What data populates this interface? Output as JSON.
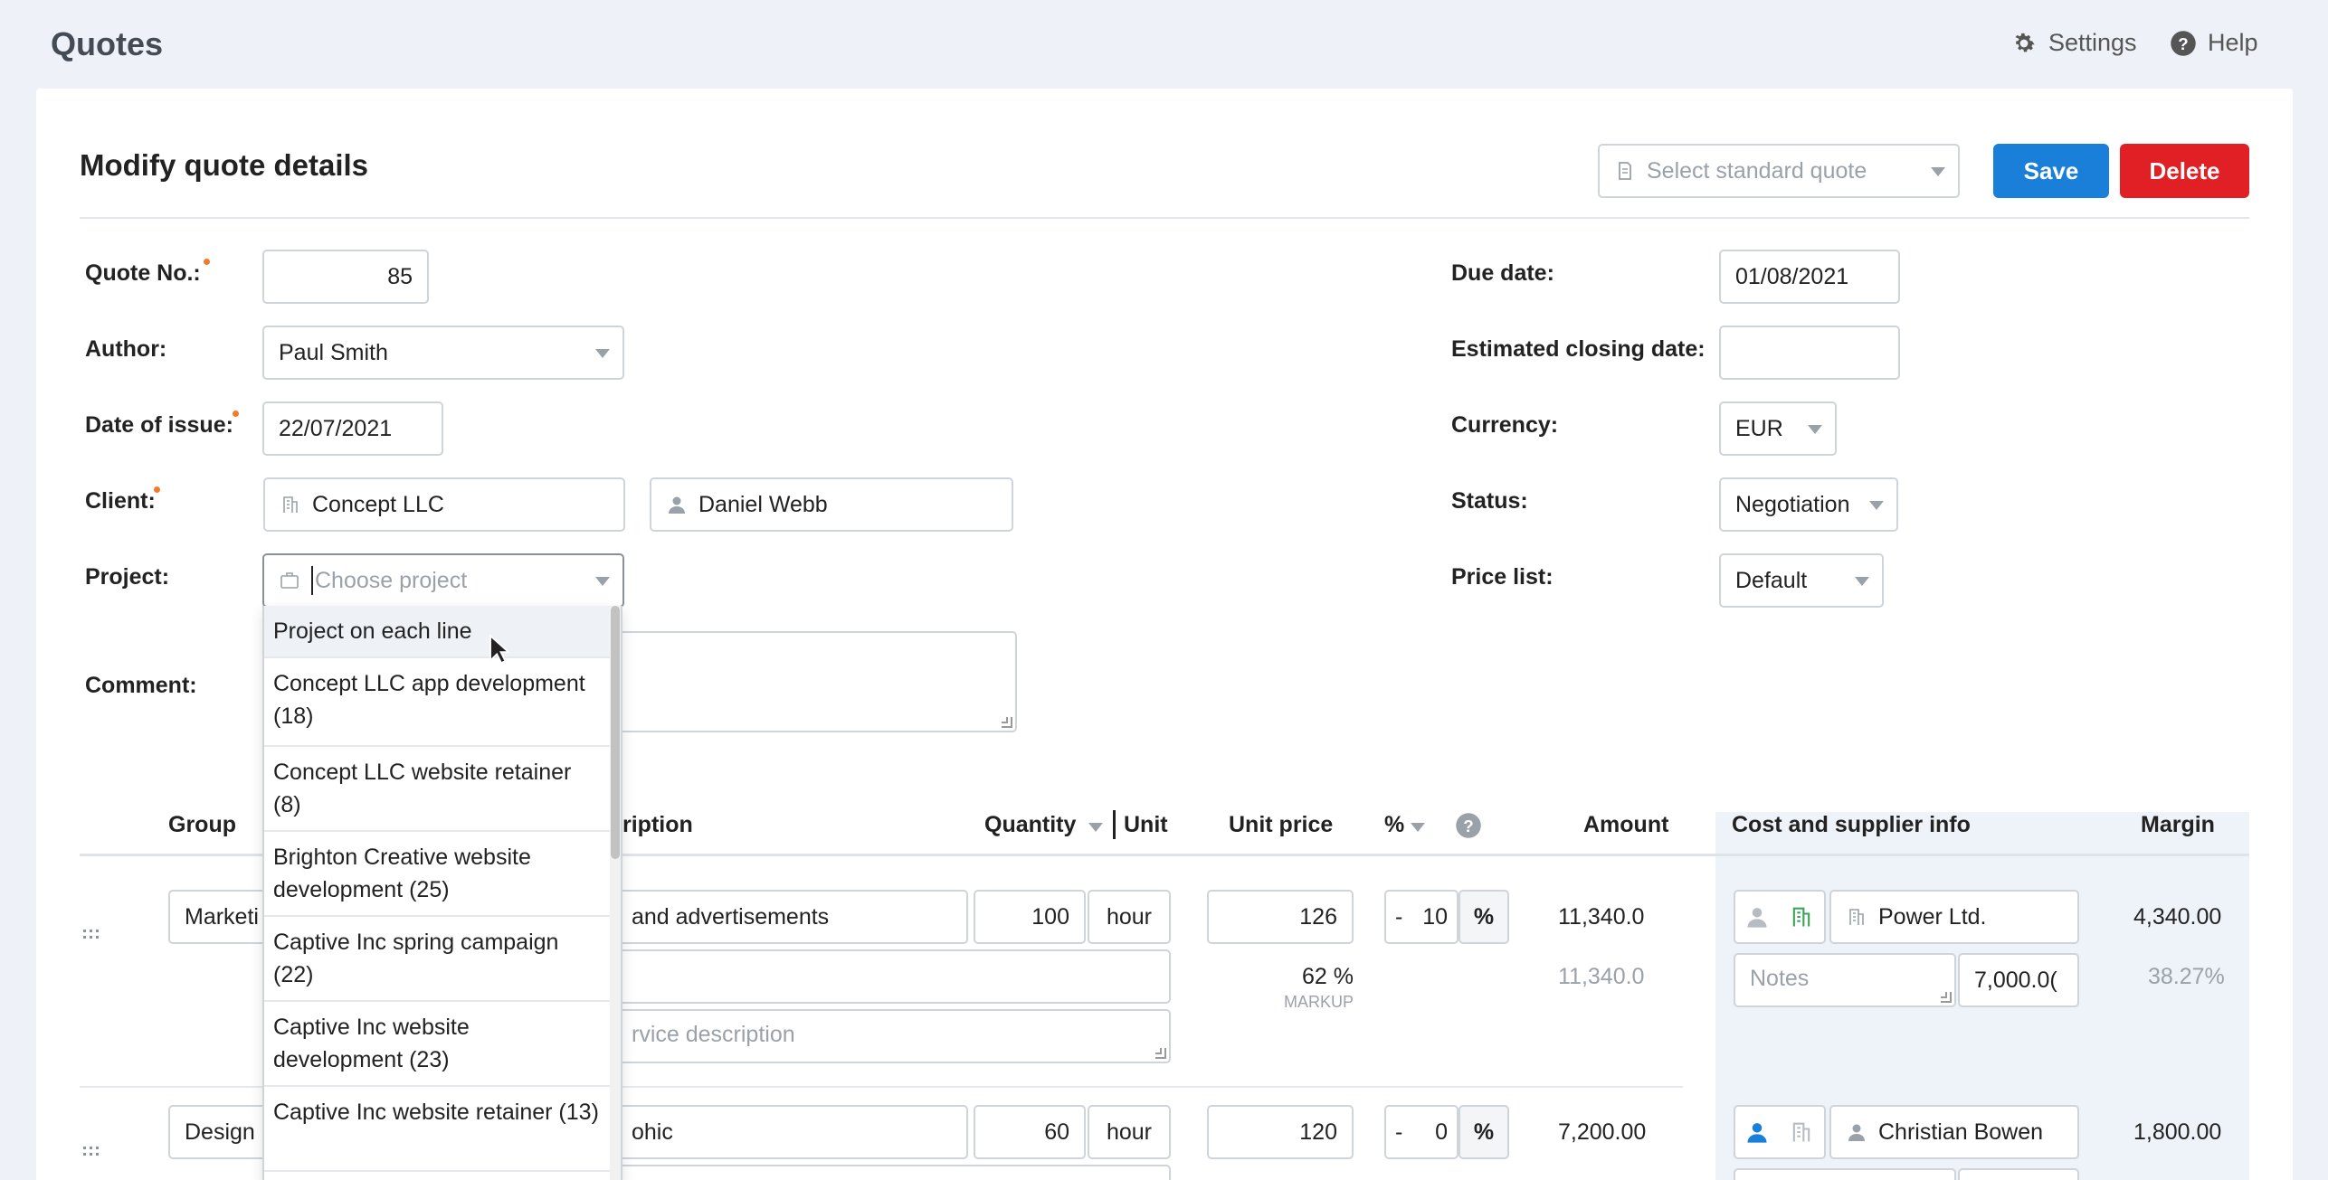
{
  "app_title": "Quotes",
  "topnav": {
    "settings": "Settings",
    "help": "Help"
  },
  "card_title": "Modify quote details",
  "standard_quote_placeholder": "Select standard quote",
  "buttons": {
    "save": "Save",
    "delete": "Delete"
  },
  "form": {
    "quote_no_label": "Quote No.:",
    "quote_no": "85",
    "author_label": "Author:",
    "author": "Paul Smith",
    "date_issue_label": "Date of issue:",
    "date_issue": "22/07/2021",
    "client_label": "Client:",
    "client": "Concept LLC",
    "contact": "Daniel Webb",
    "project_label": "Project:",
    "project_placeholder": "Choose project",
    "comment_label": "Comment:",
    "due_label": "Due date:",
    "due": "01/08/2021",
    "closing_label": "Estimated closing date:",
    "closing": "",
    "currency_label": "Currency:",
    "currency": "EUR",
    "status_label": "Status:",
    "status": "Negotiation",
    "pricelist_label": "Price list:",
    "pricelist": "Default"
  },
  "table": {
    "headers": {
      "group": "Group",
      "description": "ription",
      "quantity": "Quantity",
      "unit": "Unit",
      "unit_price": "Unit price",
      "percent": "%",
      "amount": "Amount",
      "cost": "Cost and supplier info",
      "margin": "Margin"
    },
    "rows": [
      {
        "group": "Marketi",
        "description": "and advertisements",
        "qty": "100",
        "unit": "hour",
        "price": "126",
        "disc_sign": "-",
        "disc": "10",
        "pct": "%",
        "amount": "11,340.0",
        "amount2": "11,340.0",
        "markup_pct": "62 %",
        "markup_label": "MARKUP",
        "desc_placeholder": "rvice description",
        "supplier": "Power Ltd.",
        "notes_placeholder": "Notes",
        "cost": "7,000.0(",
        "margin": "4,340.00",
        "margin_pct": "38.27%"
      },
      {
        "group": "Design",
        "description": "ohic",
        "qty": "60",
        "unit": "hour",
        "price": "120",
        "disc_sign": "-",
        "disc": "0",
        "pct": "%",
        "amount": "7,200.00",
        "supplier": "Christian Bowen",
        "margin": "1,800.00"
      }
    ]
  },
  "dropdown": {
    "items": [
      {
        "label": "Project on each line"
      },
      {
        "label": "Concept LLC app development (18)"
      },
      {
        "label": "Concept LLC website retainer (8)"
      },
      {
        "label": "Brighton Creative website development (25)"
      },
      {
        "label": "Captive Inc spring campaign (22)"
      },
      {
        "label": "Captive Inc website development (23)"
      },
      {
        "label": "Captive Inc website retainer (13)"
      }
    ]
  },
  "colors": {
    "primary": "#1a7fd9",
    "danger": "#e02024",
    "required": "#f07b2a",
    "supplier_active": "#1a7fd9",
    "company_green": "#3aa655"
  }
}
